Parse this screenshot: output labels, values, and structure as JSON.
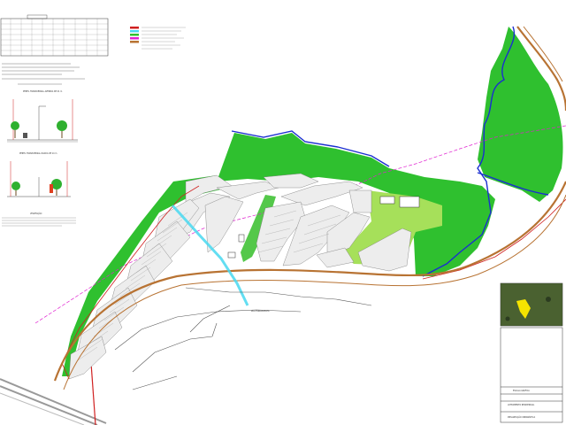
{
  "sheet": {
    "section_titles": [
      "PERFIL TRANSVERSAL AVENIDA DE 21 m",
      "PERFIL TRANSVERSAL RUADA DE 14 m",
      "VEGETAÇÃO"
    ],
    "road_label": "RUA FARROUPILHA"
  },
  "title_block": {
    "company": "ESCALA GRÁFICA",
    "project": "LOTEAMENTO RESIDENCIAL",
    "drawing": "IMPLANTAÇÃO URBANÍSTICA"
  },
  "colors": {
    "green_area": "#2fc02f",
    "light_green": "#a6e05a",
    "blue_boundary": "#1a2ed0",
    "magenta_line": "#e020d0",
    "red_line": "#d02020",
    "brown_road": "#b87333",
    "cyan_channel": "#48d8f0",
    "lot_grey": "#e6e6e6"
  }
}
